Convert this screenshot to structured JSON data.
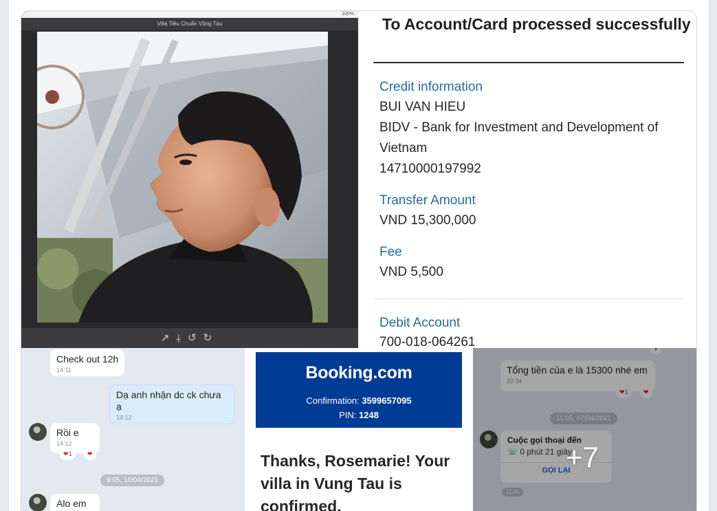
{
  "viewer": {
    "status_text": "100%",
    "title": "Villa Tiêu Chuẩn Vũng Tàu",
    "toolbar_icons": [
      "share-icon",
      "download-icon",
      "rotate-left-icon",
      "rotate-right-icon"
    ],
    "toolbar_glyphs": "↗⤓↺↻"
  },
  "receipt": {
    "title": "To Account/Card processed successfully",
    "credit_label": "Credit information",
    "credit_name": "BUI VAN HIEU",
    "credit_bank": "BIDV - Bank for Investment and Development of Vietnam",
    "credit_account": "14710000197992",
    "amount_label": "Transfer Amount",
    "amount_value": "VND 15,300,000",
    "fee_label": "Fee",
    "fee_value": "VND 5,500",
    "debit_label": "Debit Account",
    "debit_value": "700-018-064261"
  },
  "chat1": {
    "msg1_text": "Check out 12h",
    "msg1_time": "14:11",
    "msg2_text": "Dạ anh nhận dc ck chưa ạ",
    "msg2_time": "14:12",
    "msg3_text": "Rồi e",
    "msg3_time": "14:12",
    "react_count": "1",
    "date_pill": "9:05, 10/04/2021",
    "msg4_text": "Alo em"
  },
  "booking": {
    "logo": "Booking.com",
    "confirmation_label": "Confirmation:",
    "confirmation_number": "3599657095",
    "pin_label": "PIN:",
    "pin_value": "1248",
    "thanks": "Thanks, Rosemarie! Your villa in Vung Tau is confirmed."
  },
  "chat2": {
    "msg_text": "Tổng tiền của e là 15300 nhé em",
    "msg_time": "20:34",
    "react_count": "1",
    "date_pill": "11:05, 07/04/2021",
    "call_title": "Cuộc gọi thoại đến",
    "call_duration": "0 phút 21 giây",
    "call_button": "GỌI LẠI",
    "call_time": "11:05",
    "more_count": "+7"
  },
  "colors": {
    "booking_blue": "#003b95",
    "label_blue": "#2a6a9c",
    "brand_red": "#c8102e"
  }
}
